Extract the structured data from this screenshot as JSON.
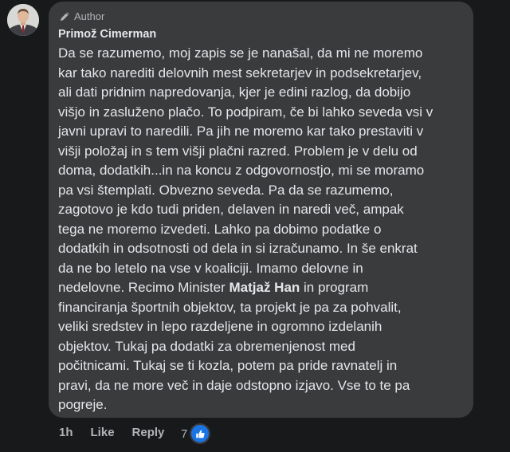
{
  "comment": {
    "badge_label": "Author",
    "author_name": "Primož Cimerman",
    "lines": [
      "Da se razumemo, moj zapis se je nanašal, da mi ne moremo",
      "kar tako narediti delovnih mest sekretarjev in podsekretarjev,",
      "ali dati pridnim napredovanja, kjer je edini razlog, da dobijo",
      "višjo in zasluženo plačo. To podpiram, če bi lahko seveda vsi v",
      "javni upravi to naredili. Pa jih ne moremo kar tako prestaviti v",
      "višji položaj in s tem višji plačni razred. Problem je v delu od",
      "doma, dodatkih...in na koncu z odgovornostjo, mi se moramo",
      "pa vsi štemplati. Obvezno seveda. Pa da se razumemo,",
      "zagotovo je kdo tudi priden, delaven in naredi več, ampak",
      "tega ne moremo izvedeti. Lahko pa dobimo podatke o",
      "dodatkih in odsotnosti od dela in si izračunamo. In še enkrat",
      "da ne bo letelo na vse v koaliciji. Imamo delovne in",
      "nedelovne. Recimo Minister ",
      "financiranja športnih objektov, ta projekt je pa za pohvalit,",
      "veliki sredstev in lepo razdeljene in ogromno izdelanih",
      "objektov. Tukaj pa dodatki za obremenjenost med",
      "počitnicami. Tukaj se ti kozla, potem pa pride ravnatelj in",
      "pravi, da ne more več in daje odstopno izjavo. Vse to te pa",
      "pogreje."
    ],
    "mention": "Matjaž Han",
    "line13_tail": " in program"
  },
  "actions": {
    "time": "1h",
    "like": "Like",
    "reply": "Reply"
  },
  "reactions": {
    "count": "7",
    "icon": "thumbs-up-icon"
  },
  "colors": {
    "background": "#18191a",
    "bubble": "#3a3b3c",
    "text": "#e4e6eb",
    "muted": "#b0b3b8",
    "like_blue": "#1b74e4"
  }
}
